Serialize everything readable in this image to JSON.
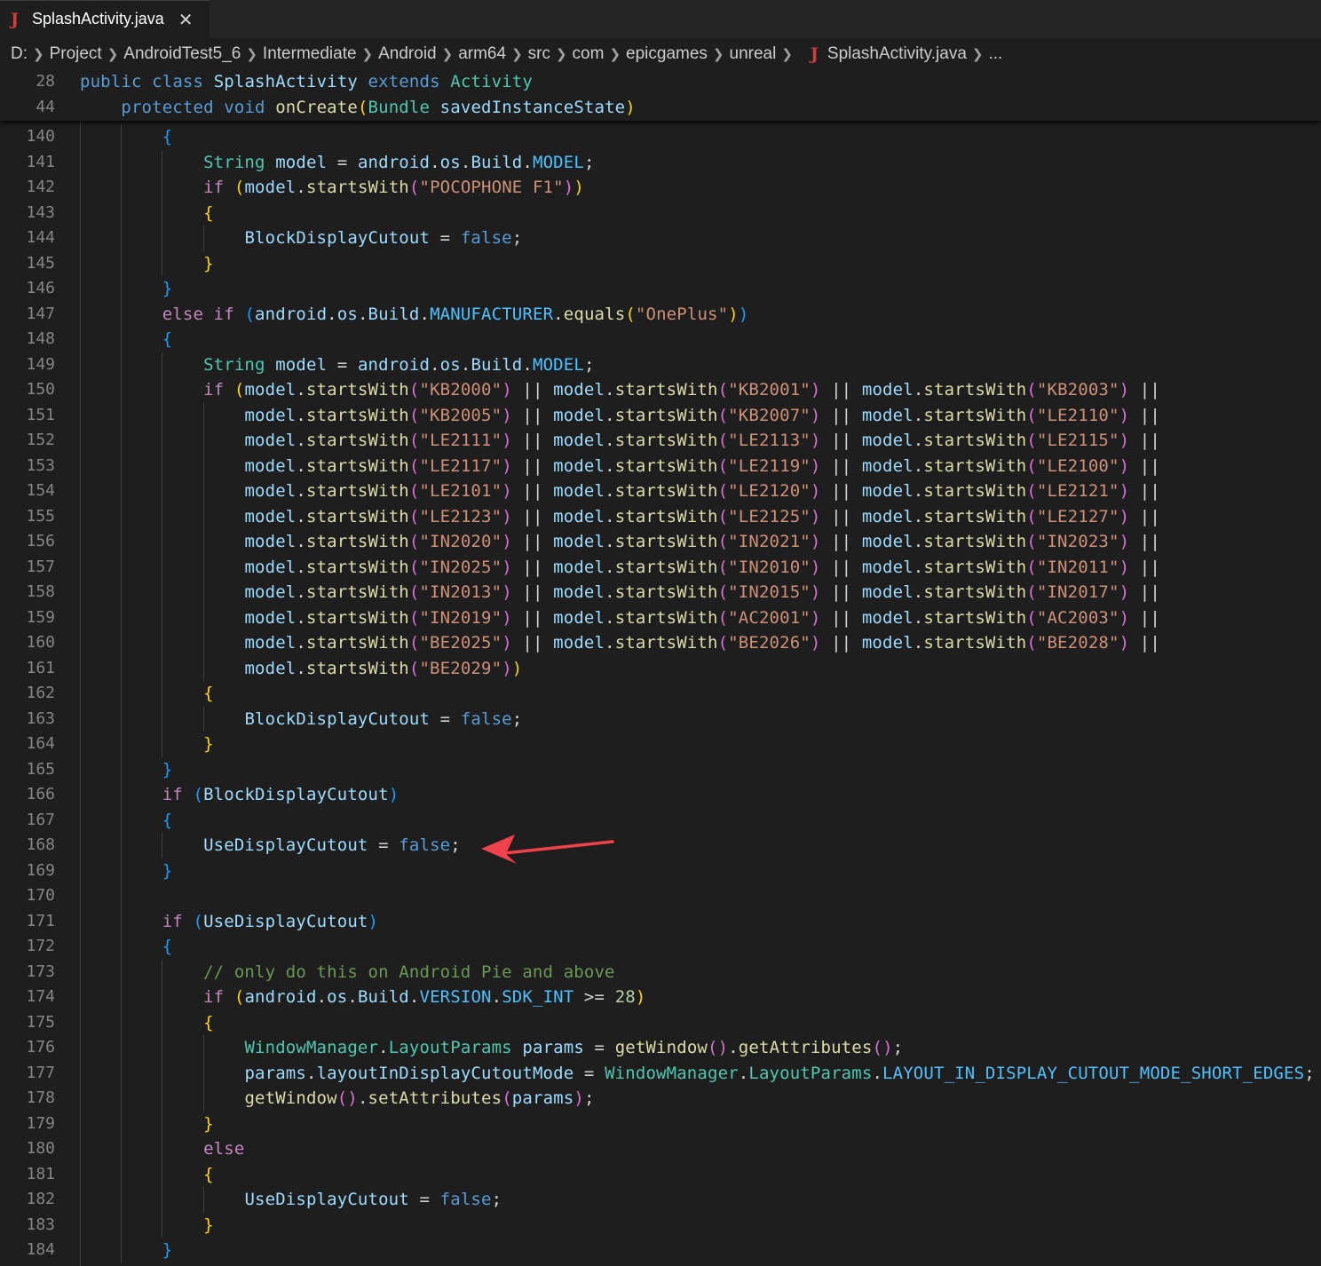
{
  "tab": {
    "label": "SplashActivity.java",
    "icon": "java-file-icon",
    "close": "✕"
  },
  "breadcrumb": {
    "items": [
      "D:",
      "Project",
      "AndroidTest5_6",
      "Intermediate",
      "Android",
      "arm64",
      "src",
      "com",
      "epicgames",
      "unreal"
    ],
    "file": "SplashActivity.java",
    "more": "..."
  },
  "sticky_lines": [
    {
      "num": "28",
      "code": "public class SplashActivity extends Activity"
    },
    {
      "num": "44",
      "code": "    protected void onCreate(Bundle savedInstanceState)"
    }
  ],
  "lines": [
    {
      "num": "140",
      "code": "        {"
    },
    {
      "num": "141",
      "code": "            String model = android.os.Build.MODEL;"
    },
    {
      "num": "142",
      "code": "            if (model.startsWith(\"POCOPHONE F1\"))"
    },
    {
      "num": "143",
      "code": "            {"
    },
    {
      "num": "144",
      "code": "                BlockDisplayCutout = false;"
    },
    {
      "num": "145",
      "code": "            }"
    },
    {
      "num": "146",
      "code": "        }"
    },
    {
      "num": "147",
      "code": "        else if (android.os.Build.MANUFACTURER.equals(\"OnePlus\"))"
    },
    {
      "num": "148",
      "code": "        {"
    },
    {
      "num": "149",
      "code": "            String model = android.os.Build.MODEL;"
    },
    {
      "num": "150",
      "code": "            if (model.startsWith(\"KB2000\") || model.startsWith(\"KB2001\") || model.startsWith(\"KB2003\") ||"
    },
    {
      "num": "151",
      "code": "                model.startsWith(\"KB2005\") || model.startsWith(\"KB2007\") || model.startsWith(\"LE2110\") ||"
    },
    {
      "num": "152",
      "code": "                model.startsWith(\"LE2111\") || model.startsWith(\"LE2113\") || model.startsWith(\"LE2115\") ||"
    },
    {
      "num": "153",
      "code": "                model.startsWith(\"LE2117\") || model.startsWith(\"LE2119\") || model.startsWith(\"LE2100\") ||"
    },
    {
      "num": "154",
      "code": "                model.startsWith(\"LE2101\") || model.startsWith(\"LE2120\") || model.startsWith(\"LE2121\") ||"
    },
    {
      "num": "155",
      "code": "                model.startsWith(\"LE2123\") || model.startsWith(\"LE2125\") || model.startsWith(\"LE2127\") ||"
    },
    {
      "num": "156",
      "code": "                model.startsWith(\"IN2020\") || model.startsWith(\"IN2021\") || model.startsWith(\"IN2023\") ||"
    },
    {
      "num": "157",
      "code": "                model.startsWith(\"IN2025\") || model.startsWith(\"IN2010\") || model.startsWith(\"IN2011\") ||"
    },
    {
      "num": "158",
      "code": "                model.startsWith(\"IN2013\") || model.startsWith(\"IN2015\") || model.startsWith(\"IN2017\") ||"
    },
    {
      "num": "159",
      "code": "                model.startsWith(\"IN2019\") || model.startsWith(\"AC2001\") || model.startsWith(\"AC2003\") ||"
    },
    {
      "num": "160",
      "code": "                model.startsWith(\"BE2025\") || model.startsWith(\"BE2026\") || model.startsWith(\"BE2028\") ||"
    },
    {
      "num": "161",
      "code": "                model.startsWith(\"BE2029\"))"
    },
    {
      "num": "162",
      "code": "            {"
    },
    {
      "num": "163",
      "code": "                BlockDisplayCutout = false;"
    },
    {
      "num": "164",
      "code": "            }"
    },
    {
      "num": "165",
      "code": "        }"
    },
    {
      "num": "166",
      "code": "        if (BlockDisplayCutout)"
    },
    {
      "num": "167",
      "code": "        {"
    },
    {
      "num": "168",
      "code": "            UseDisplayCutout = false;"
    },
    {
      "num": "169",
      "code": "        }"
    },
    {
      "num": "170",
      "code": ""
    },
    {
      "num": "171",
      "code": "        if (UseDisplayCutout)"
    },
    {
      "num": "172",
      "code": "        {"
    },
    {
      "num": "173",
      "code": "            // only do this on Android Pie and above"
    },
    {
      "num": "174",
      "code": "            if (android.os.Build.VERSION.SDK_INT >= 28)"
    },
    {
      "num": "175",
      "code": "            {"
    },
    {
      "num": "176",
      "code": "                WindowManager.LayoutParams params = getWindow().getAttributes();"
    },
    {
      "num": "177",
      "code": "                params.layoutInDisplayCutoutMode = WindowManager.LayoutParams.LAYOUT_IN_DISPLAY_CUTOUT_MODE_SHORT_EDGES;"
    },
    {
      "num": "178",
      "code": "                getWindow().setAttributes(params);"
    },
    {
      "num": "179",
      "code": "            }"
    },
    {
      "num": "180",
      "code": "            else"
    },
    {
      "num": "181",
      "code": "            {"
    },
    {
      "num": "182",
      "code": "                UseDisplayCutout = false;"
    },
    {
      "num": "183",
      "code": "            }"
    },
    {
      "num": "184",
      "code": "        }"
    }
  ],
  "annotation": {
    "arrow_target_line": "168"
  },
  "colors": {
    "background": "#1e1e1e",
    "keyword": "#569cd6",
    "control": "#c586c0",
    "type": "#4ec9b0",
    "function": "#dcdcaa",
    "variable": "#9cdcfe",
    "string": "#ce9178",
    "arrow": "#f0424a"
  }
}
